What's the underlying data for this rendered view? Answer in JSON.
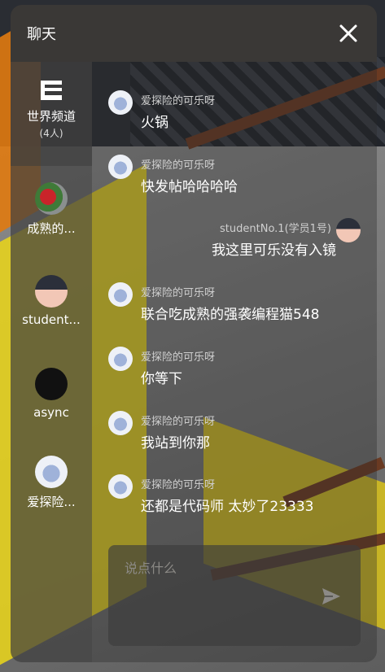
{
  "header": {
    "title": "聊天"
  },
  "sidebar": {
    "world": {
      "label": "世界频道",
      "count": "(4人)"
    },
    "items": [
      {
        "label": "成熟的..."
      },
      {
        "label": "student..."
      },
      {
        "label": "async"
      },
      {
        "label": "爱探险..."
      }
    ]
  },
  "messages": [
    {
      "sender": "爱探险的可乐呀",
      "text": "火锅"
    },
    {
      "sender": "爱探险的可乐呀",
      "text": "快发帖哈哈哈哈"
    },
    {
      "sender": "studentNo.1(学员1号)",
      "text": "我这里可乐没有入镜"
    },
    {
      "sender": "爱探险的可乐呀",
      "text": "联合吃成熟的强袭编程猫548"
    },
    {
      "sender": "爱探险的可乐呀",
      "text": "你等下"
    },
    {
      "sender": "爱探险的可乐呀",
      "text": "我站到你那"
    },
    {
      "sender": "爱探险的可乐呀",
      "text": "还都是代码师 太妙了23333"
    }
  ],
  "composer": {
    "placeholder": "说点什么"
  }
}
